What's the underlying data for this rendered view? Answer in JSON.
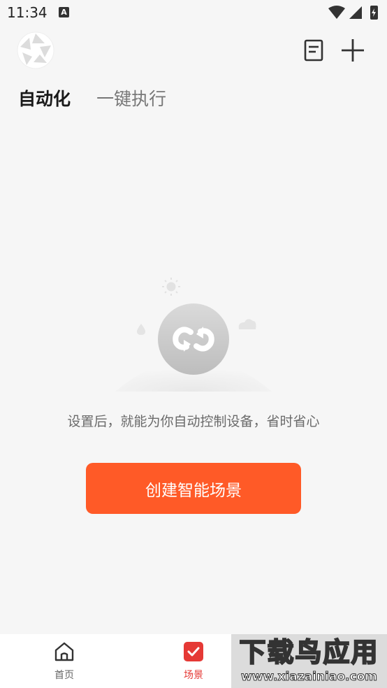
{
  "status_bar": {
    "time": "11:34",
    "notification_badge": "A"
  },
  "header": {
    "logo_icon": "aperture-logo-icon",
    "notes_icon": "notes-icon",
    "add_icon": "plus-icon"
  },
  "tabs": [
    {
      "label": "自动化",
      "active": true
    },
    {
      "label": "一键执行",
      "active": false
    }
  ],
  "empty_state": {
    "illustration": "sync-loop-icon",
    "message": "设置后，就能为你自动控制设备，省时省心"
  },
  "create_button": {
    "label": "创建智能场景",
    "color": "#ff5a27"
  },
  "bottom_nav": [
    {
      "label": "首页",
      "icon": "home-icon",
      "active": false
    },
    {
      "label": "场景",
      "icon": "scene-check-icon",
      "active": true,
      "color": "#e53935"
    }
  ],
  "watermark": {
    "title": "下载鸟应用",
    "url": "www.xiazainiao.com"
  }
}
